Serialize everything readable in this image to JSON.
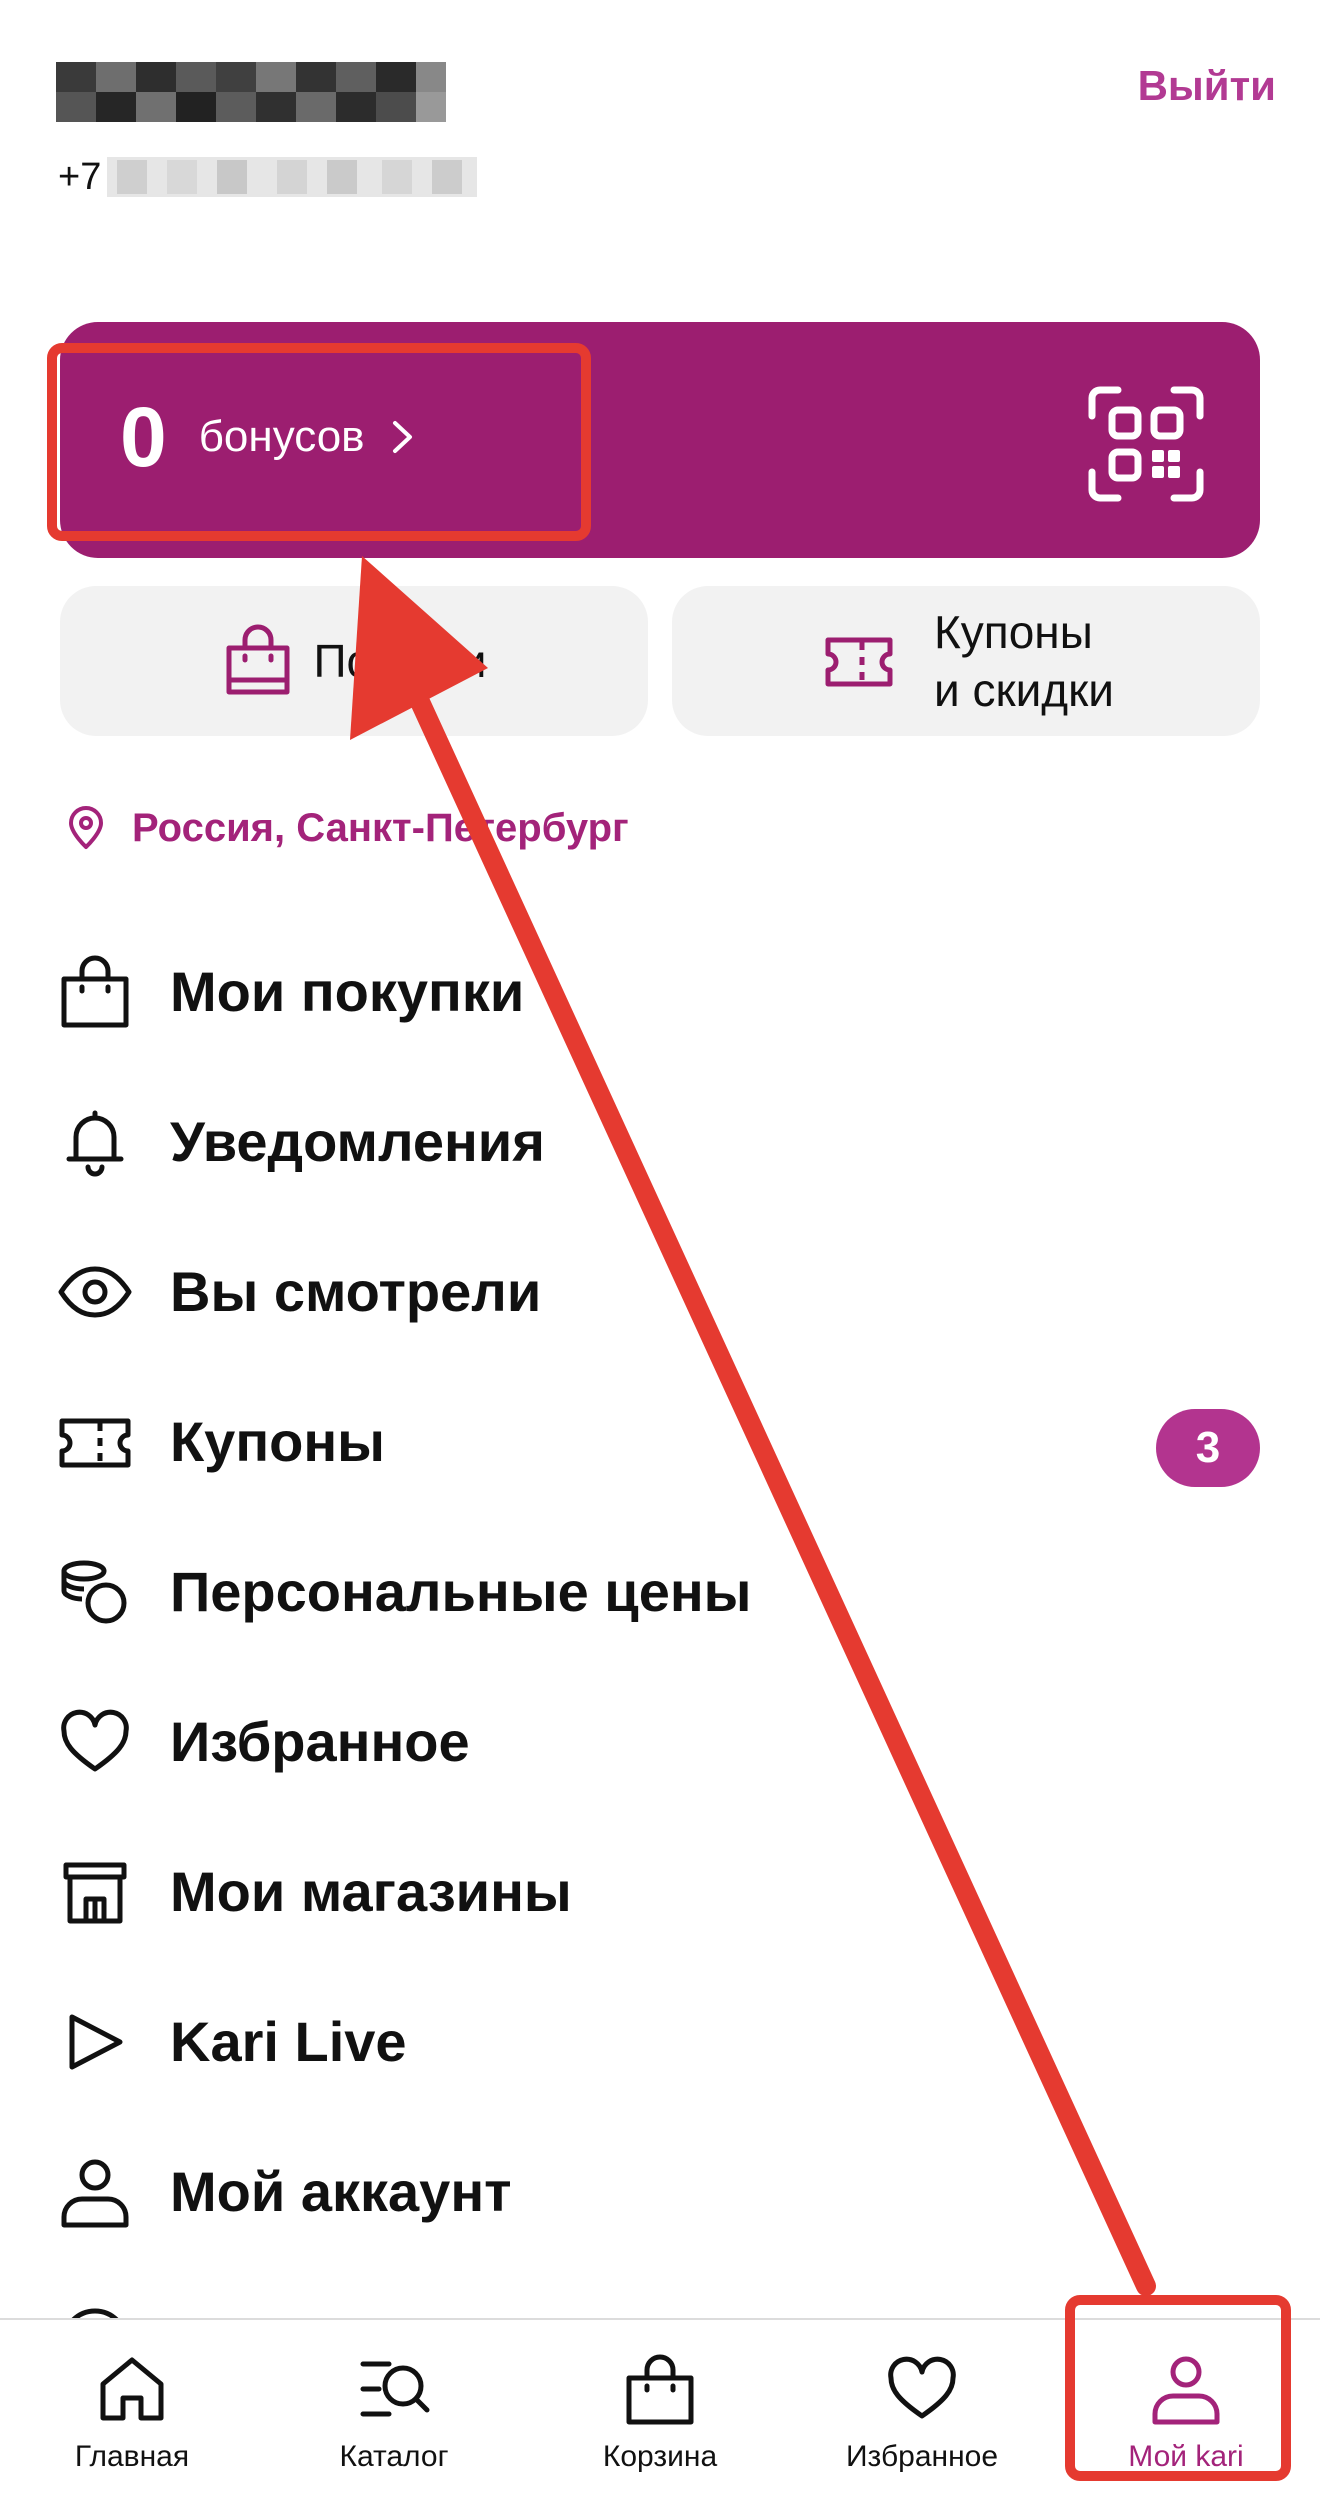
{
  "header": {
    "phone_prefix": "+7",
    "logout_label": "Выйти"
  },
  "bonus": {
    "count": "0",
    "label": "бонусов"
  },
  "tiles": {
    "purchases_label": "Покупки",
    "coupons_line1": "Купоны",
    "coupons_line2": "и скидки"
  },
  "location": {
    "text": "Россия, Санкт-Петербург"
  },
  "menu": {
    "items": [
      {
        "label": "Мои покупки",
        "icon": "shopping-bag-icon"
      },
      {
        "label": "Уведомления",
        "icon": "bell-icon"
      },
      {
        "label": "Вы смотрели",
        "icon": "eye-icon"
      },
      {
        "label": "Купоны",
        "icon": "ticket-icon",
        "badge": "3"
      },
      {
        "label": "Персональные цены",
        "icon": "coins-icon"
      },
      {
        "label": "Избранное",
        "icon": "heart-icon"
      },
      {
        "label": "Мои магазины",
        "icon": "store-icon"
      },
      {
        "label": "Kari Live",
        "icon": "play-icon"
      },
      {
        "label": "Мой аккаунт",
        "icon": "user-icon"
      }
    ]
  },
  "tabbar": {
    "tabs": [
      {
        "label": "Главная",
        "icon": "home-icon"
      },
      {
        "label": "Каталог",
        "icon": "catalog-search-icon"
      },
      {
        "label": "Корзина",
        "icon": "cart-bag-icon"
      },
      {
        "label": "Избранное",
        "icon": "heart-icon"
      },
      {
        "label": "Мой kari",
        "icon": "user-icon",
        "active": true
      }
    ]
  },
  "colors": {
    "brand": "#9c1e70",
    "accent_text": "#a3237a",
    "badge": "#b3348f",
    "tile_bg": "#f2f2f2",
    "annotation_red": "#e53a30"
  }
}
